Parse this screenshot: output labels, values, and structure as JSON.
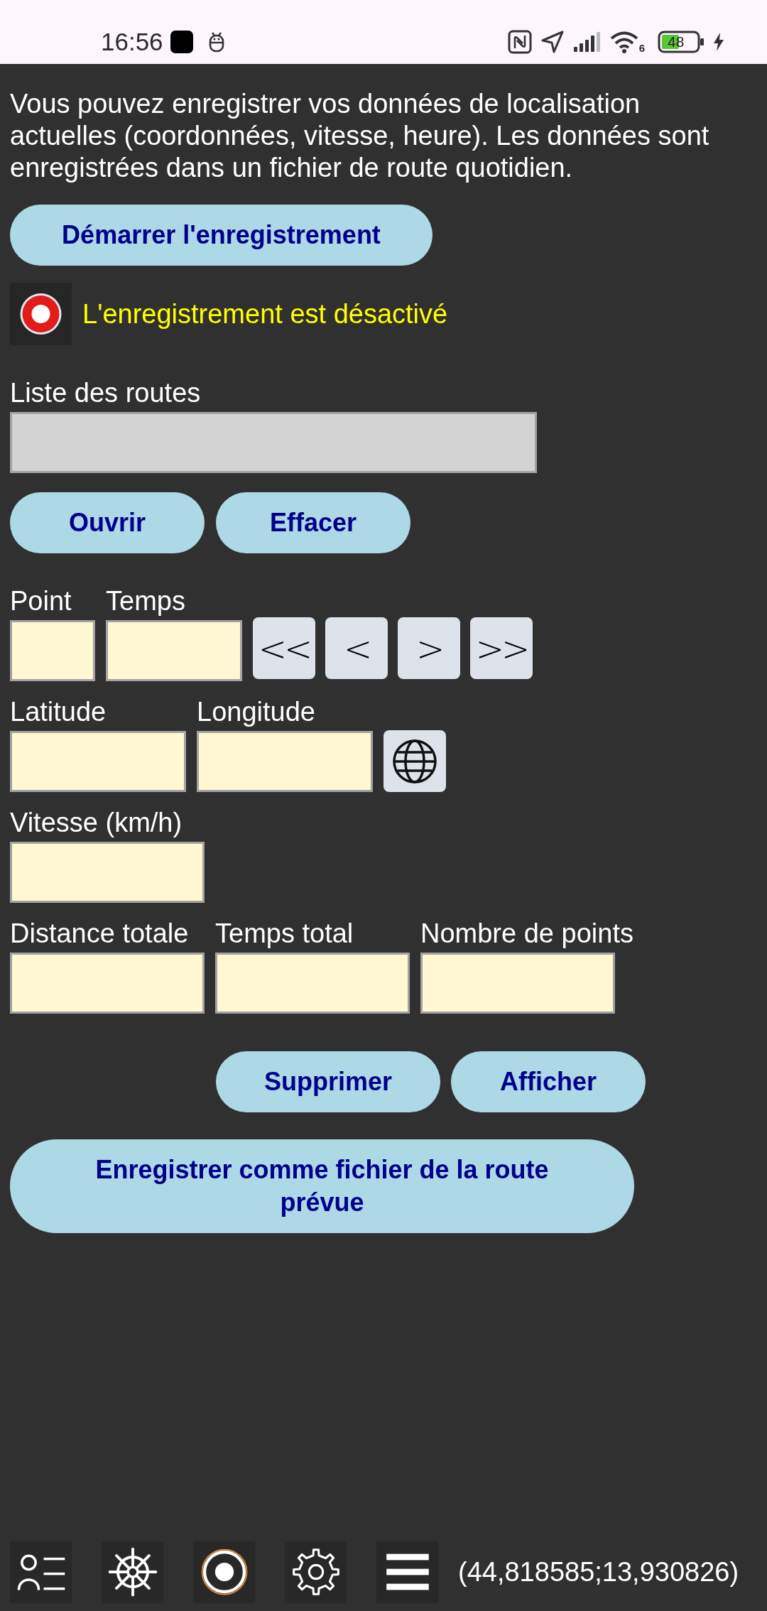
{
  "status_bar": {
    "time": "16:56",
    "wifi_band": "6",
    "battery": "48"
  },
  "intro": "Vous pouvez enregistrer vos données de localisation actuelles (coordonnées, vitesse, heure). Les données sont enregistrées dans un fichier de route quotidien.",
  "record_button": "Démarrer l'enregistrement",
  "record_status": "L'enregistrement est désactivé",
  "route_list": {
    "label": "Liste des routes"
  },
  "route_buttons": [
    "Ouvrir",
    "Effacer"
  ],
  "point_row": {
    "fields": [
      {
        "label": "Point"
      },
      {
        "label": "Temps"
      }
    ],
    "nav_buttons": [
      "<<",
      "<",
      ">",
      ">>"
    ]
  },
  "position_row": {
    "fields": [
      {
        "label": "Latitude"
      },
      {
        "label": "Longitude"
      }
    ]
  },
  "speed_row": {
    "fields": [
      {
        "label": "Vitesse (km/h)"
      }
    ]
  },
  "totals_row": {
    "fields": [
      {
        "label": "Distance totale"
      },
      {
        "label": "Temps total"
      },
      {
        "label": "Nombre de points"
      }
    ]
  },
  "action_buttons": [
    "Supprimer",
    "Afficher"
  ],
  "save_button": "Enregistrer comme fichier de la route prévue",
  "bottom_bar": {
    "coordinates": "(44,818585;13,930826)"
  }
}
